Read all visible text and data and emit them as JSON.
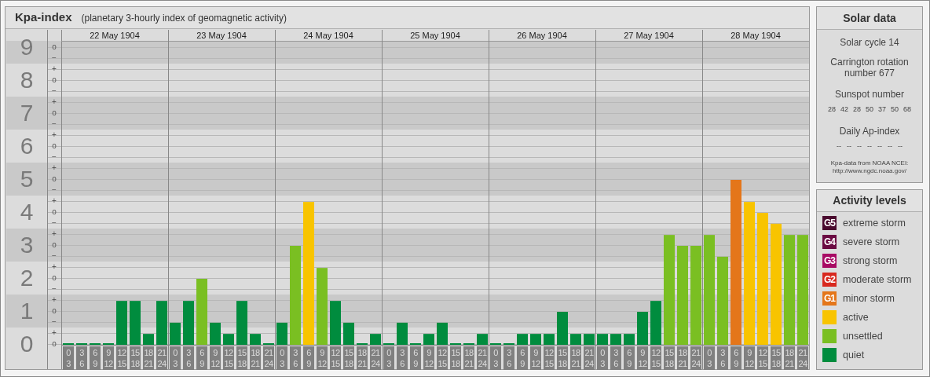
{
  "header": {
    "title": "Kpa-index",
    "subtitle": "(planetary 3-hourly index of geomagnetic activity)"
  },
  "sub_ticks": [
    {
      "marks": [
        "o",
        "−"
      ]
    },
    {
      "marks": [
        "+",
        "o",
        "−"
      ]
    },
    {
      "marks": [
        "+",
        "o",
        "−"
      ]
    },
    {
      "marks": [
        "+",
        "o",
        "−"
      ]
    },
    {
      "marks": [
        "+",
        "o",
        "−"
      ]
    },
    {
      "marks": [
        "+",
        "o",
        "−"
      ]
    },
    {
      "marks": [
        "+",
        "o",
        "−"
      ]
    },
    {
      "marks": [
        "+",
        "o",
        "−"
      ]
    },
    {
      "marks": [
        "+",
        "o",
        "−"
      ]
    },
    {
      "marks": [
        "+",
        "o"
      ]
    }
  ],
  "days": [
    "22 May 1904",
    "23 May 1904",
    "24 May 1904",
    "25 May 1904",
    "26 May 1904",
    "27 May 1904",
    "28 May 1904"
  ],
  "chart_data": {
    "type": "bar",
    "grid": true,
    "ylim": [
      0,
      9
    ],
    "bands": [
      {
        "axis": "y",
        "from": 8.5,
        "to": 9.2
      },
      {
        "axis": "y",
        "from": 6.5,
        "to": 7.5
      },
      {
        "axis": "y",
        "from": 4.5,
        "to": 5.5
      },
      {
        "axis": "y",
        "from": 2.5,
        "to": 3.5
      },
      {
        "axis": "y",
        "from": 0.5,
        "to": 1.5
      }
    ],
    "yticks": [
      0,
      1,
      2,
      3,
      4,
      5,
      6,
      7,
      8,
      9
    ],
    "categories": [
      "0 3",
      "3 6",
      "6 9",
      "9 12",
      "12 15",
      "15 18",
      "18 21",
      "21 24",
      "0 3",
      "3 6",
      "6 9",
      "9 12",
      "12 15",
      "15 18",
      "18 21",
      "21 24",
      "0 3",
      "3 6",
      "6 9",
      "9 12",
      "12 15",
      "15 18",
      "18 21",
      "21 24",
      "0 3",
      "3 6",
      "6 9",
      "9 12",
      "12 15",
      "15 18",
      "18 21",
      "21 24",
      "0 3",
      "3 6",
      "6 9",
      "9 12",
      "12 15",
      "15 18",
      "18 21",
      "21 24",
      "0 3",
      "3 6",
      "6 9",
      "9 12",
      "12 15",
      "15 18",
      "18 21",
      "21 24",
      "0 3",
      "3 6",
      "6 9",
      "9 12",
      "12 15",
      "15 18",
      "18 21",
      "21 24"
    ],
    "series": [
      {
        "values": [
          0,
          0,
          0,
          0,
          1.33,
          1.33,
          0.33,
          1.33,
          0.67,
          1.33,
          2,
          0.67,
          0.33,
          1.33,
          0.33,
          0,
          0.67,
          3,
          4.33,
          2.33,
          1.33,
          0.67,
          0,
          0.33,
          0,
          0.67,
          0,
          0.33,
          0.67,
          0,
          0,
          0.33,
          0,
          0,
          0.33,
          0.33,
          0.33,
          1,
          0.33,
          0.33,
          0.33,
          0.33,
          0.33,
          1,
          1.33,
          3.33,
          3,
          3,
          3.33,
          2.67,
          5,
          4.33,
          4,
          3.67,
          3.33,
          3.33
        ]
      }
    ]
  },
  "solar_data": {
    "title": "Solar data",
    "solar_cycle": "Solar cycle 14",
    "carrington": "Carrington rotation number 677",
    "sunspot_label": "Sunspot number",
    "sunspots": [
      "28",
      "42",
      "28",
      "50",
      "37",
      "50",
      "68"
    ],
    "ap_label": "Daily Ap-index",
    "ap_values": [
      "--",
      "--",
      "--",
      "--",
      "--",
      "--",
      "--"
    ],
    "source": "Kpa-data from NOAA NCEI:",
    "source_url": "http://www.ngdc.noaa.gov/"
  },
  "activity_levels": {
    "title": "Activity levels",
    "items": [
      {
        "badge": "G5",
        "label": "extreme storm",
        "color": "#4a0a2e"
      },
      {
        "badge": "G4",
        "label": "severe storm",
        "color": "#6b0a42"
      },
      {
        "badge": "G3",
        "label": "strong storm",
        "color": "#a80a64"
      },
      {
        "badge": "G2",
        "label": "moderate storm",
        "color": "#d8281e"
      },
      {
        "badge": "G1",
        "label": "minor storm",
        "color": "#e4761a"
      },
      {
        "label": "active",
        "color": "#f8c400"
      },
      {
        "label": "unsettled",
        "color": "#7abf22"
      },
      {
        "label": "quiet",
        "color": "#008c3e"
      }
    ]
  }
}
